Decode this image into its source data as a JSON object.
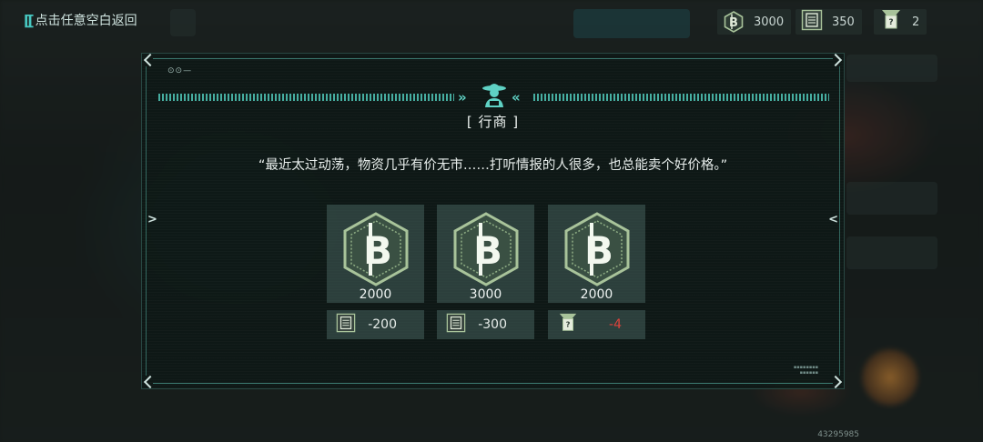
{
  "header": {
    "back_label": "点击任意空白返回",
    "resources": [
      {
        "icon": "coin-icon",
        "value": "3000"
      },
      {
        "icon": "supply-icon",
        "value": "350"
      },
      {
        "icon": "intel-icon",
        "value": "2"
      }
    ]
  },
  "dialog": {
    "speaker": "[ 行商 ]",
    "quote": "“最近太过动荡，物资几乎有价无市……打听情报的人很多，也总能卖个好价格。”",
    "offers": [
      {
        "reward_icon": "coin-icon",
        "reward": "2000",
        "cost_icon": "supply-icon",
        "cost": "-200",
        "cost_color": "#e6ece9"
      },
      {
        "reward_icon": "coin-icon",
        "reward": "3000",
        "cost_icon": "supply-icon",
        "cost": "-300",
        "cost_color": "#e6ece9"
      },
      {
        "reward_icon": "coin-icon",
        "reward": "2000",
        "cost_icon": "intel-icon",
        "cost": "-4",
        "cost_color": "#e0433c"
      }
    ]
  },
  "footer": {
    "id_text": "43295985"
  },
  "colors": {
    "accent": "#47c7c0",
    "negative": "#e0433c",
    "coin": "#a8c39a"
  }
}
